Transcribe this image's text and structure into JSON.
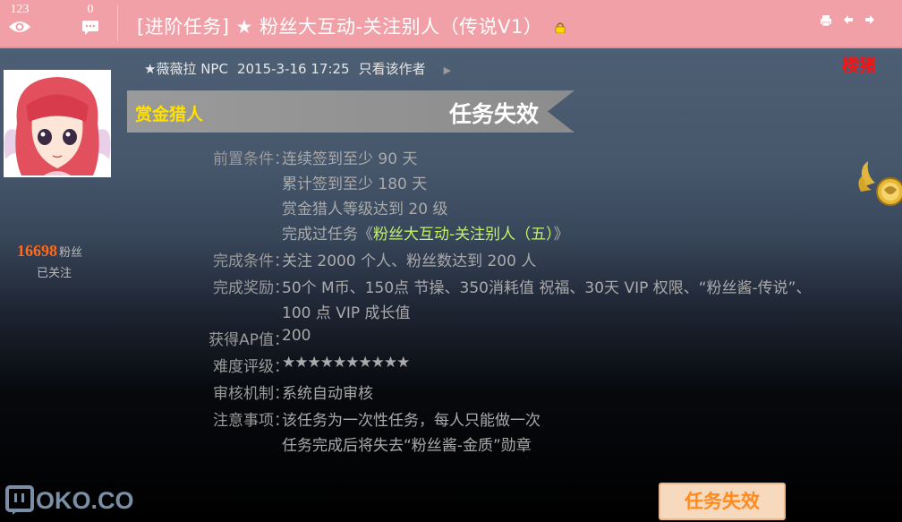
{
  "header": {
    "views": "123",
    "comments": "0",
    "title": "[进阶任务] ★ 粉丝大互动-关注别人（传说V1）",
    "icons": [
      "eye-icon",
      "comment-icon",
      "lock-icon",
      "print-icon",
      "prev-arrow-icon",
      "next-arrow-icon"
    ]
  },
  "user": {
    "fans_count": "16698",
    "fans_label": "粉丝",
    "follow_status": "已关注"
  },
  "post": {
    "author": "★薇薇拉 NPC",
    "datetime": "2015-3-16 17:25",
    "only_author": "只看该作者",
    "floor_label": "楼猪"
  },
  "banner": {
    "left": "赏金猎人",
    "right": "任务失效"
  },
  "task": {
    "pre_label": "前置条件：",
    "pre_1": "连续签到至少 90 天",
    "pre_2": "累计签到至少 180 天",
    "pre_3": "赏金猎人等级达到 20 级",
    "pre_4_prefix": "完成过任务《",
    "pre_4_link": "粉丝大互动-关注别人（五）",
    "pre_4_suffix": "》",
    "complete_label": "完成条件：",
    "complete_value": "关注 2000 个人、粉丝数达到 200 人",
    "reward_label": "完成奖励：",
    "reward_1": "50个 M币、150点 节操、350消耗值 祝福、30天 VIP 权限、“粉丝酱-传说”、",
    "reward_2": "100 点 VIP 成长值",
    "ap_label": "获得AP值：",
    "ap_value": "200",
    "difficulty_label": "难度评级：",
    "difficulty_value": "★★★★★★★★★★",
    "review_label": "审核机制：",
    "review_value": "系统自动审核",
    "note_label": "注意事项：",
    "note_1": "该任务为一次性任务，每人只能做一次",
    "note_2": "任务完成后将失去“粉丝酱-金质”勋章"
  },
  "watermark": "OKO.CO",
  "button": "任务失效"
}
